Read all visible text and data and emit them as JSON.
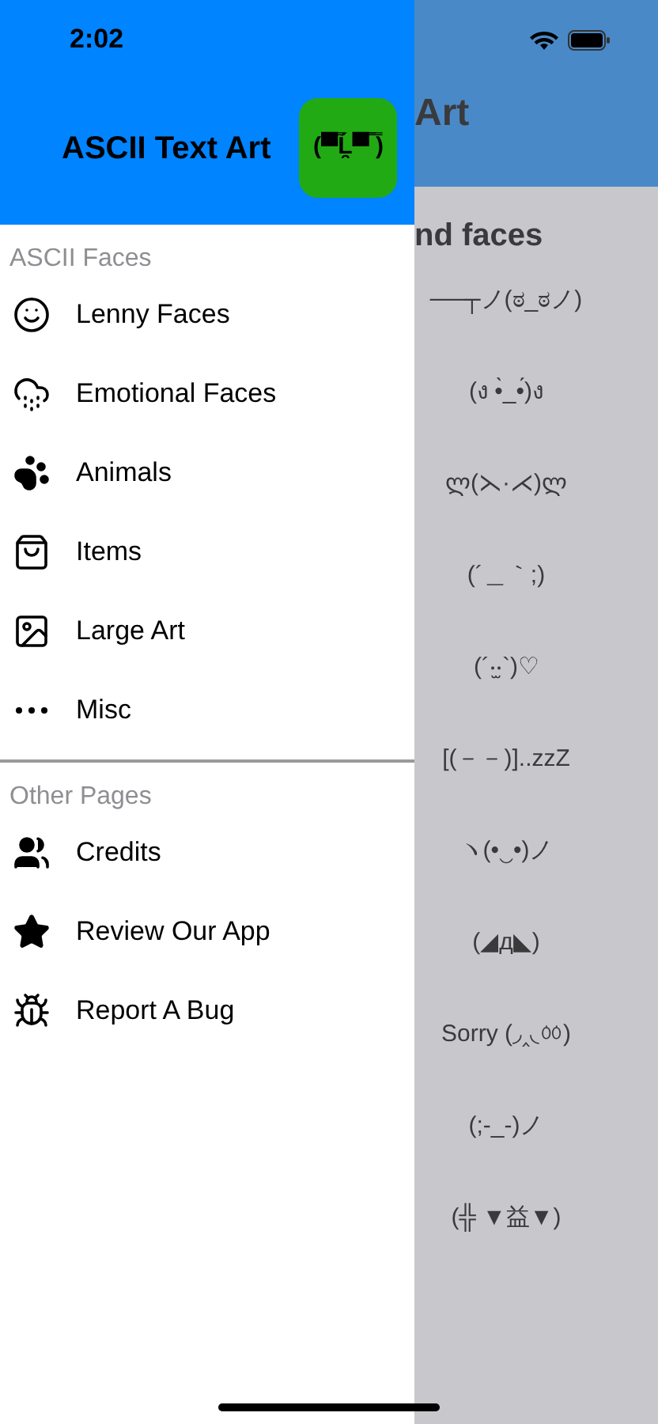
{
  "status_bar": {
    "time": "2:02"
  },
  "drawer": {
    "title": "ASCII Text Art",
    "app_icon_text": "(▀̿Ĺ̯▀̿ ̿)",
    "sections": [
      {
        "header": "ASCII Faces",
        "items": [
          {
            "label": "Lenny Faces"
          },
          {
            "label": "Emotional Faces"
          },
          {
            "label": "Animals"
          },
          {
            "label": "Items"
          },
          {
            "label": "Large Art"
          },
          {
            "label": "Misc"
          }
        ]
      },
      {
        "header": "Other Pages",
        "items": [
          {
            "label": "Credits"
          },
          {
            "label": "Review Our App"
          },
          {
            "label": "Report A Bug"
          }
        ]
      }
    ]
  },
  "background_page": {
    "title": "Art",
    "section_title": "nd faces",
    "faces": [
      "──┬ノ(ಠ_ಠノ)",
      "(ง •̀_•́)ง",
      "ლ(⋋·⋌)ლ",
      "(´＿｀;)",
      "(´‧̫‧`)♡",
      "[(－－)]..zzZ",
      "ヽ(•‿•)ノ",
      "(◢д◣)",
      "Sorry (◞‸◟ㆀ)",
      "(;-_-)ノ",
      "(╬ ▼益▼)"
    ]
  }
}
